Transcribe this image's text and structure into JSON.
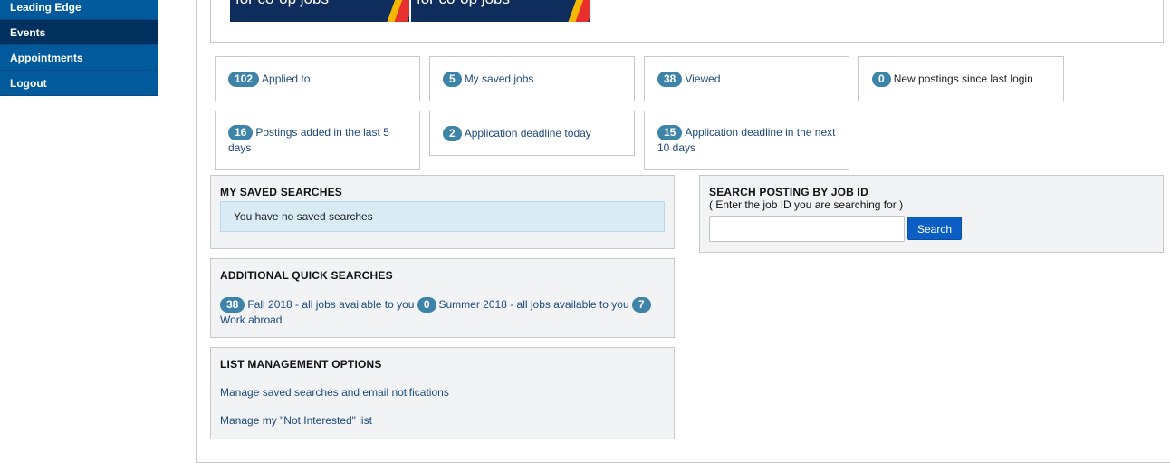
{
  "sidebar": {
    "items": [
      {
        "label": "Leading Edge"
      },
      {
        "label": "Events"
      },
      {
        "label": "Appointments"
      },
      {
        "label": "Logout"
      }
    ]
  },
  "banners": [
    {
      "text": "for co-op jobs"
    },
    {
      "text": "for co-op jobs"
    }
  ],
  "stats": [
    {
      "count": "102",
      "label": "Applied to"
    },
    {
      "count": "5",
      "label": "My saved jobs"
    },
    {
      "count": "38",
      "label": "Viewed"
    },
    {
      "count": "0",
      "label": "New postings since last login"
    },
    {
      "count": "16",
      "label": "Postings added in the last 5 days"
    },
    {
      "count": "2",
      "label": "Application deadline today"
    },
    {
      "count": "15",
      "label": "Application deadline in the next 10 days"
    }
  ],
  "saved_searches": {
    "title": "MY SAVED SEARCHES",
    "empty_message": "You have no saved searches"
  },
  "job_id_search": {
    "title": "SEARCH POSTING BY JOB ID",
    "hint": "( Enter the job ID you are searching for )",
    "input_value": "",
    "button_label": "Search"
  },
  "quick_searches": {
    "title": "ADDITIONAL QUICK SEARCHES",
    "items": [
      {
        "count": "38",
        "label": "Fall 2018 - all jobs available to you"
      },
      {
        "count": "0",
        "label": "Summer 2018 - all jobs available to you"
      },
      {
        "count": "7",
        "label": "Work abroad"
      }
    ]
  },
  "list_management": {
    "title": "LIST MANAGEMENT OPTIONS",
    "links": [
      {
        "label": "Manage saved searches and email notifications"
      },
      {
        "label": "Manage my \"Not Interested\" list"
      }
    ]
  },
  "colors": {
    "sidebar": "#005a9c",
    "sidebar_active": "#00305e",
    "badge": "#3d84a8",
    "link": "#1c4a7a",
    "search_button": "#0b5fc4"
  }
}
